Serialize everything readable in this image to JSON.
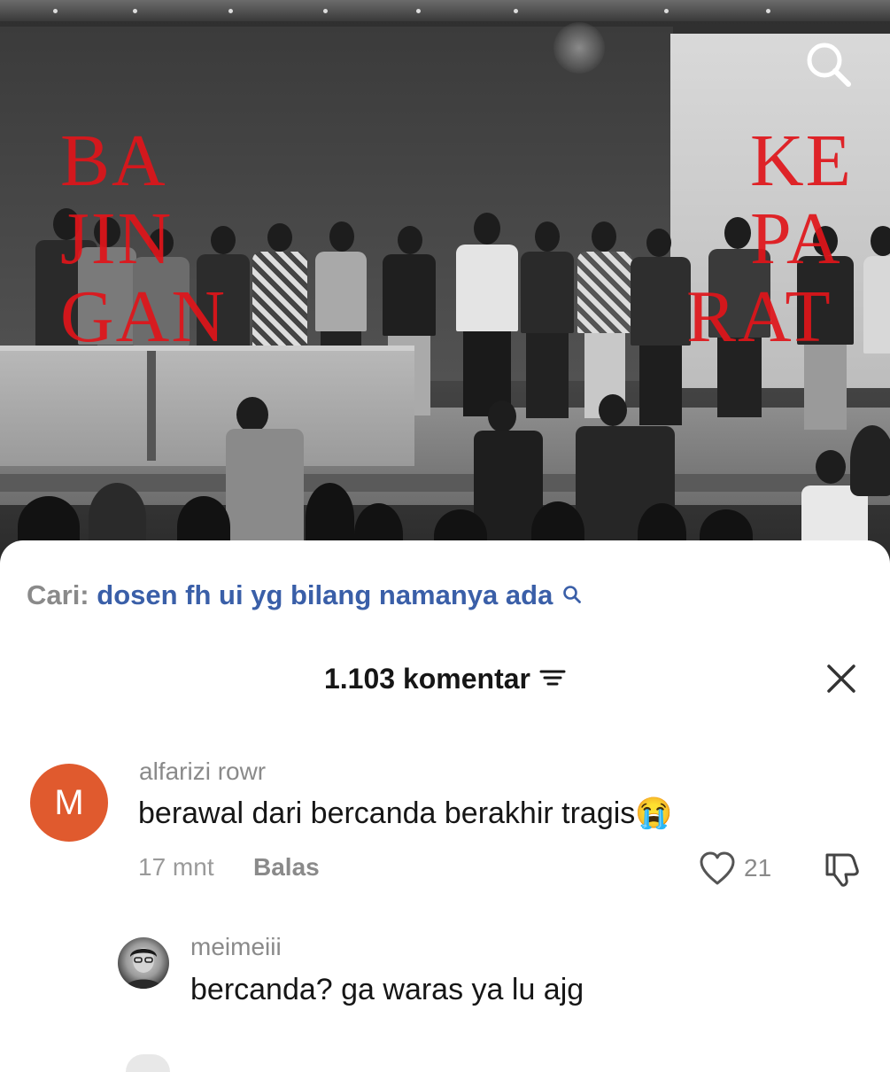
{
  "video": {
    "overlay_left": [
      "BA",
      "JIN",
      "GAN"
    ],
    "overlay_right": [
      "KE",
      "PA",
      "RAT"
    ],
    "search_icon": "search-icon"
  },
  "search": {
    "prefix": "Cari:",
    "query": "dosen fh ui yg bilang namanya ada",
    "icon": "search-icon"
  },
  "comments_header": {
    "count_label": "1.103 komentar",
    "sort_icon": "sort-icon",
    "close_icon": "close-icon"
  },
  "comments": [
    {
      "avatar_letter": "M",
      "avatar_color": "#e05a2e",
      "username": "alfarizi rowr",
      "text": "berawal dari bercanda berakhir tragis😭",
      "time": "17 mnt",
      "reply_label": "Balas",
      "likes": "21"
    }
  ],
  "replies": [
    {
      "username": "meimeiii",
      "text": "bercanda? ga waras ya lu ajg"
    }
  ],
  "colors": {
    "link_blue": "#3a5fa8",
    "overlay_red": "#e0151a",
    "muted_gray": "#8a8a8a"
  }
}
